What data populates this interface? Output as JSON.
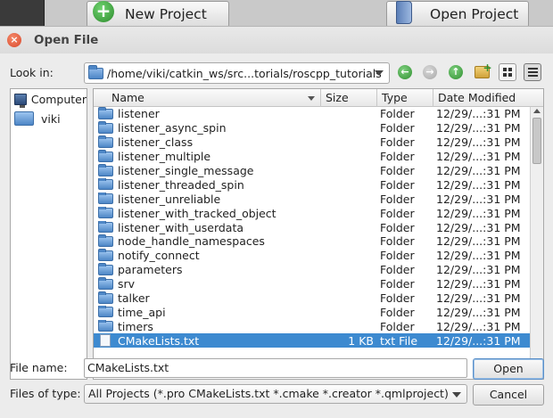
{
  "background": {
    "new_project_label": "New Project",
    "open_project_label": "Open Project"
  },
  "dialog": {
    "title": "Open File",
    "look_in_label": "Look in:",
    "path": "/home/viki/catkin_ws/src...torials/roscpp_tutorials",
    "sidebar": [
      {
        "label": "Computer",
        "icon": "computer-icon"
      },
      {
        "label": "viki",
        "icon": "folder-icon"
      }
    ],
    "columns": {
      "name": "Name",
      "size": "Size",
      "type": "Type",
      "date": "Date Modified"
    },
    "files": [
      {
        "name": "listener",
        "size": "",
        "type": "Folder",
        "date": "12/29/...:31 PM"
      },
      {
        "name": "listener_async_spin",
        "size": "",
        "type": "Folder",
        "date": "12/29/...:31 PM"
      },
      {
        "name": "listener_class",
        "size": "",
        "type": "Folder",
        "date": "12/29/...:31 PM"
      },
      {
        "name": "listener_multiple",
        "size": "",
        "type": "Folder",
        "date": "12/29/...:31 PM"
      },
      {
        "name": "listener_single_message",
        "size": "",
        "type": "Folder",
        "date": "12/29/...:31 PM"
      },
      {
        "name": "listener_threaded_spin",
        "size": "",
        "type": "Folder",
        "date": "12/29/...:31 PM"
      },
      {
        "name": "listener_unreliable",
        "size": "",
        "type": "Folder",
        "date": "12/29/...:31 PM"
      },
      {
        "name": "listener_with_tracked_object",
        "size": "",
        "type": "Folder",
        "date": "12/29/...:31 PM"
      },
      {
        "name": "listener_with_userdata",
        "size": "",
        "type": "Folder",
        "date": "12/29/...:31 PM"
      },
      {
        "name": "node_handle_namespaces",
        "size": "",
        "type": "Folder",
        "date": "12/29/...:31 PM"
      },
      {
        "name": "notify_connect",
        "size": "",
        "type": "Folder",
        "date": "12/29/...:31 PM"
      },
      {
        "name": "parameters",
        "size": "",
        "type": "Folder",
        "date": "12/29/...:31 PM"
      },
      {
        "name": "srv",
        "size": "",
        "type": "Folder",
        "date": "12/29/...:31 PM"
      },
      {
        "name": "talker",
        "size": "",
        "type": "Folder",
        "date": "12/29/...:31 PM"
      },
      {
        "name": "time_api",
        "size": "",
        "type": "Folder",
        "date": "12/29/...:31 PM"
      },
      {
        "name": "timers",
        "size": "",
        "type": "Folder",
        "date": "12/29/...:31 PM"
      },
      {
        "name": "CMakeLists.txt",
        "size": "1 KB",
        "type": "txt File",
        "date": "12/29/...:31 PM",
        "selected": true
      }
    ],
    "file_name_label": "File name:",
    "file_name_value": "CMakeLists.txt",
    "files_of_type_label": "Files of type:",
    "files_of_type_value": "All Projects (*.pro CMakeLists.txt *.cmake *.creator *.qmlproject)",
    "open_button": "Open",
    "cancel_button": "Cancel"
  }
}
